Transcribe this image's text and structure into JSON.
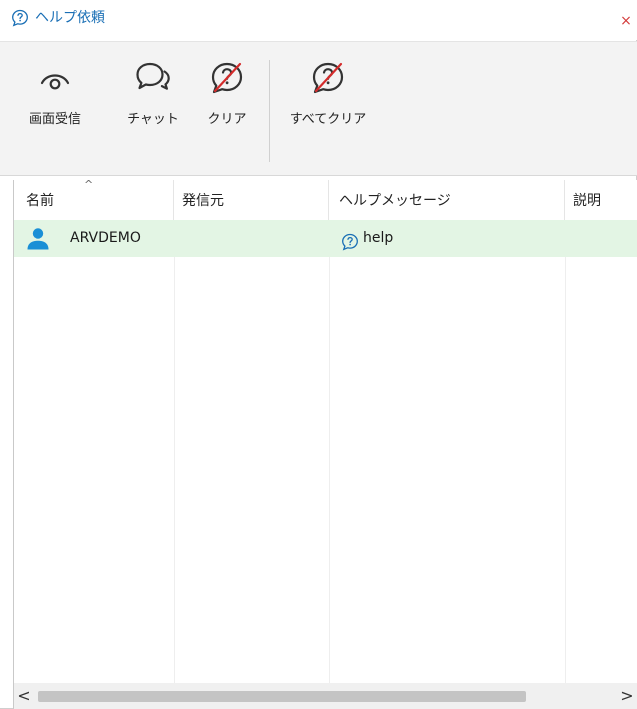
{
  "window": {
    "title": "ヘルプ依頼",
    "close_glyph": "×"
  },
  "toolbar": {
    "screen_label": "画面受信",
    "chat_label": "チャット",
    "clear_label": "クリア",
    "clear_all_label": "すべてクリア"
  },
  "table": {
    "columns": [
      "名前",
      "発信元",
      "ヘルプメッセージ",
      "説明"
    ],
    "sort_indicator": "^",
    "rows": [
      {
        "name": "ARVDEMO",
        "source": "",
        "message": "help",
        "description": ""
      }
    ]
  },
  "scrollbar": {
    "left_glyph": "<",
    "right_glyph": ">"
  },
  "colors": {
    "title_accent": "#1a6fb5",
    "selected_row": "#e3f5e4",
    "user_icon": "#1a8fd6",
    "clear_slash": "#d42b2b",
    "close": "#d43c3c"
  }
}
